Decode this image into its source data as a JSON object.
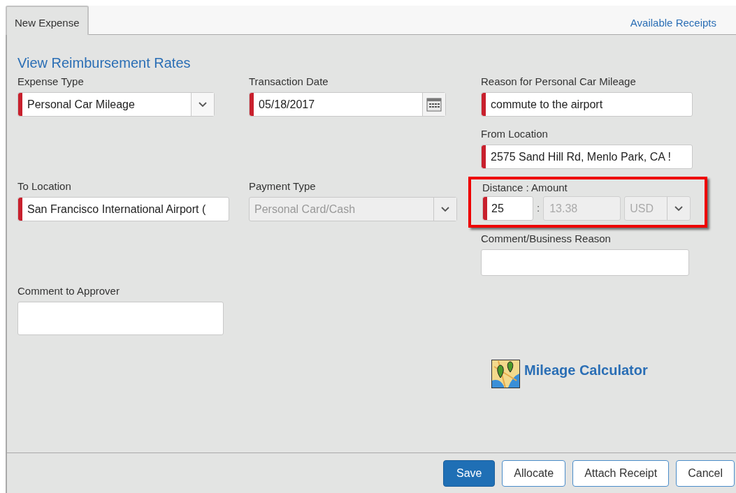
{
  "tabs": [
    {
      "label": "New Expense",
      "selected": true
    }
  ],
  "available_receipts_link": "Available Receipts",
  "rates_link": "View Reimbursement Rates",
  "columns": [
    {
      "fields": [
        {
          "kind": "select",
          "label": "Expense Type",
          "value": "Personal Car Mileage",
          "required": true,
          "disabled": false
        },
        {
          "kind": "text",
          "label": "To Location",
          "value": "San Francisco International Airport (",
          "required": true,
          "disabled": false
        },
        {
          "kind": "textarea",
          "label": "Comment to Approver",
          "required": false,
          "disabled": false
        }
      ]
    },
    {
      "fields": [
        {
          "kind": "date",
          "label": "Transaction Date",
          "value": "05/18/2017",
          "required": true,
          "disabled": false
        },
        {
          "kind": "select",
          "label": "Payment Type",
          "value": "Personal Card/Cash",
          "required": false,
          "disabled": true
        }
      ]
    },
    {
      "fields": [
        {
          "kind": "text",
          "label": "Reason for Personal Car Mileage",
          "value": "commute to the airport",
          "required": true,
          "disabled": false
        },
        {
          "kind": "text",
          "label": "From Location",
          "value": "2575 Sand Hill Rd, Menlo Park, CA !",
          "required": true,
          "disabled": false
        },
        {
          "kind": "distance",
          "label": "Distance : Amount",
          "distance": "25",
          "separator": ":",
          "amount": "13.38",
          "currency": "USD",
          "required": true,
          "disabled": true,
          "highlighted": true
        },
        {
          "kind": "text",
          "label": "Comment/Business Reason",
          "required": false,
          "disabled": false
        }
      ]
    }
  ],
  "mileage_calculator": "Mileage Calculator",
  "buttons": [
    {
      "label": "Save",
      "primary": true
    },
    {
      "label": "Allocate",
      "primary": false
    },
    {
      "label": "Attach Receipt",
      "primary": false
    },
    {
      "label": "Cancel",
      "primary": false
    }
  ]
}
